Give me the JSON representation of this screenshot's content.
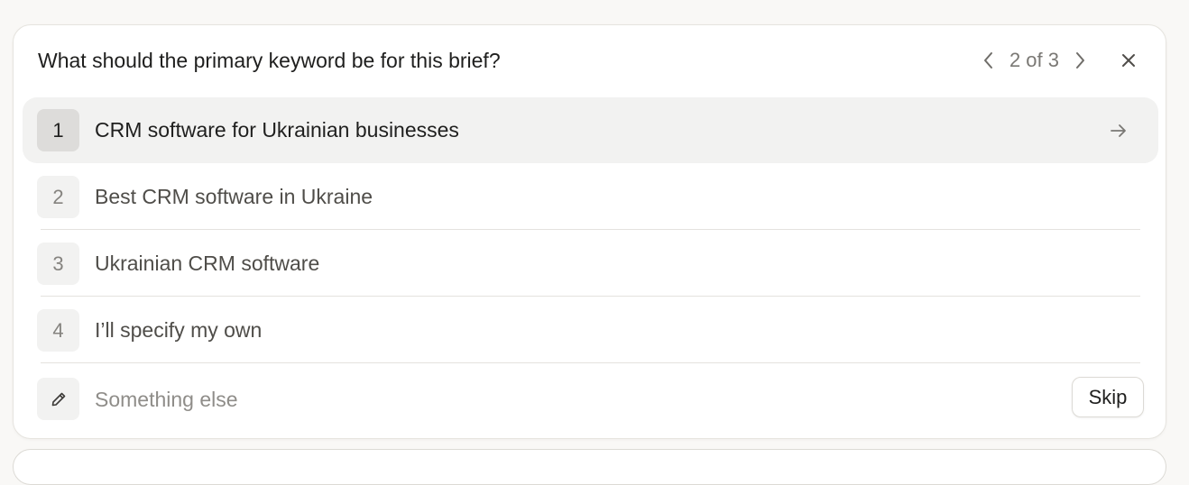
{
  "question": "What should the primary keyword be for this brief?",
  "pager": {
    "text": "2 of 3",
    "prev_icon": "chevron-left-icon",
    "next_icon": "chevron-right-icon",
    "close_icon": "close-icon"
  },
  "options": [
    {
      "number": "1",
      "label": "CRM software for Ukrainian businesses",
      "selected": true
    },
    {
      "number": "2",
      "label": "Best CRM software in Ukraine",
      "selected": false
    },
    {
      "number": "3",
      "label": "Ukrainian CRM software",
      "selected": false
    },
    {
      "number": "4",
      "label": "I’ll specify my own",
      "selected": false
    }
  ],
  "custom": {
    "icon": "pencil-icon",
    "placeholder": "Something else",
    "value": ""
  },
  "skip_label": "Skip",
  "colors": {
    "background": "#f9f8f6",
    "card": "#ffffff",
    "selected_row": "#f2f2f1",
    "text_primary": "#1f1f1e",
    "text_secondary": "#4f4d49",
    "text_muted": "#7a7874"
  }
}
